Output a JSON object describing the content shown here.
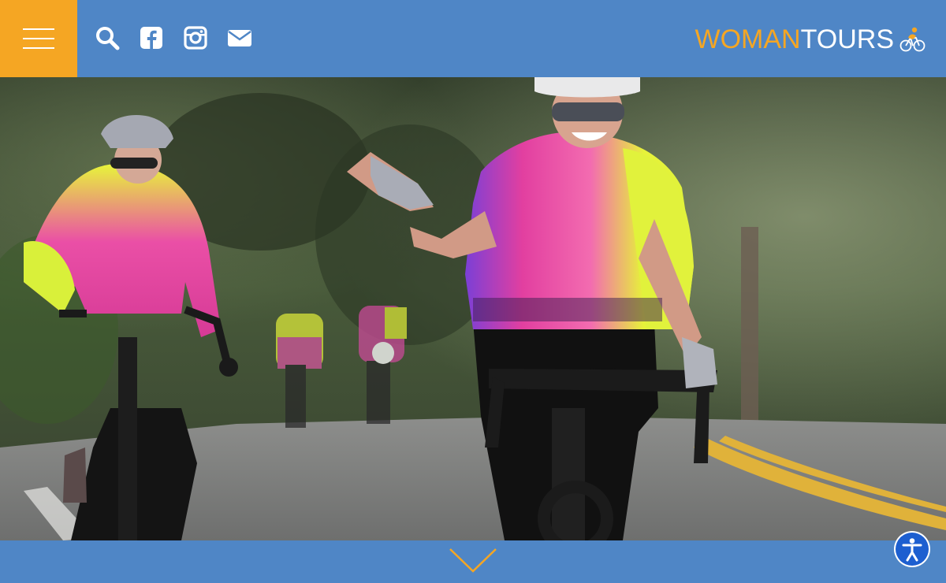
{
  "header": {
    "menu_icon": "hamburger-menu-icon",
    "social_icons": [
      "search-icon",
      "facebook-icon",
      "instagram-icon",
      "envelope-icon"
    ],
    "logo": {
      "part1": "WOMAN",
      "part2": "TOURS",
      "icon": "cyclist-logo-icon"
    }
  },
  "hero": {
    "icon": "hero-photo"
  },
  "footer": {
    "scroll_icon": "chevron-down-icon"
  },
  "accessibility": {
    "icon": "accessibility-icon"
  },
  "colors": {
    "brand_blue": "#4f86c6",
    "accent_orange": "#f5a623",
    "a11y_blue": "#1d5fd0"
  }
}
